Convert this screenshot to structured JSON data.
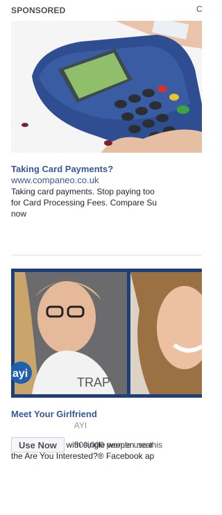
{
  "header": {
    "sponsored": "SPONSORED",
    "create_ad": "C"
  },
  "ad1": {
    "image_alt": "Card payment terminal",
    "title": "Taking Card Payments?",
    "url": "www.companeo.co.uk",
    "body_lines": [
      "Taking card payments. Stop paying too",
      "for Card Processing Fees. Compare Su",
      "now"
    ]
  },
  "ad2": {
    "image_alt": "Two women smiling",
    "logo_text": "ayi",
    "title": "Meet Your Girlfriend",
    "subtitle": "AYI",
    "body_lines": [
      "Meet and chat with single women near",
      "the Are You Interested?® Facebook ap"
    ],
    "cta_label": "Use Now",
    "usage_text": "· 500,000 people use this"
  },
  "colors": {
    "link": "#365899",
    "frame": "#1e3f78",
    "divider": "#dddfe2",
    "terminal": "#2f4e92"
  }
}
